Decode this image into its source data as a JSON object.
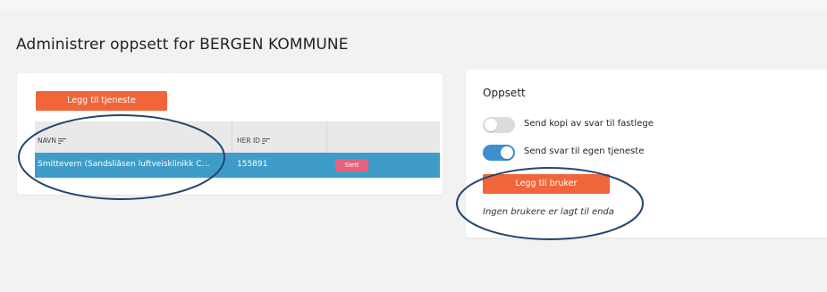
{
  "page": {
    "title": "Administrer oppsett for BERGEN KOMMUNE"
  },
  "services": {
    "add_button_label": "Legg til tjeneste",
    "columns": {
      "name": "NAVN",
      "her_id": "HER ID"
    },
    "rows": [
      {
        "name": "Smittevern (Sandsliåsen luftveisklinikk C…",
        "her_id": "155891",
        "delete_label": "Slett"
      }
    ]
  },
  "setup": {
    "title": "Oppsett",
    "toggles": [
      {
        "label": "Send kopi av svar til fastlege",
        "state": "off"
      },
      {
        "label": "Send svar til egen tjeneste",
        "state": "on"
      }
    ],
    "add_user_button_label": "Legg til bruker",
    "empty_users_text": "Ingen brukere er lagt til enda"
  },
  "colors": {
    "accent_orange": "#f0663a",
    "selected_row": "#3f9cc8",
    "toggle_on": "#3f8fd0",
    "delete_pink": "#e8607a",
    "annotation_navy": "#23466f"
  }
}
